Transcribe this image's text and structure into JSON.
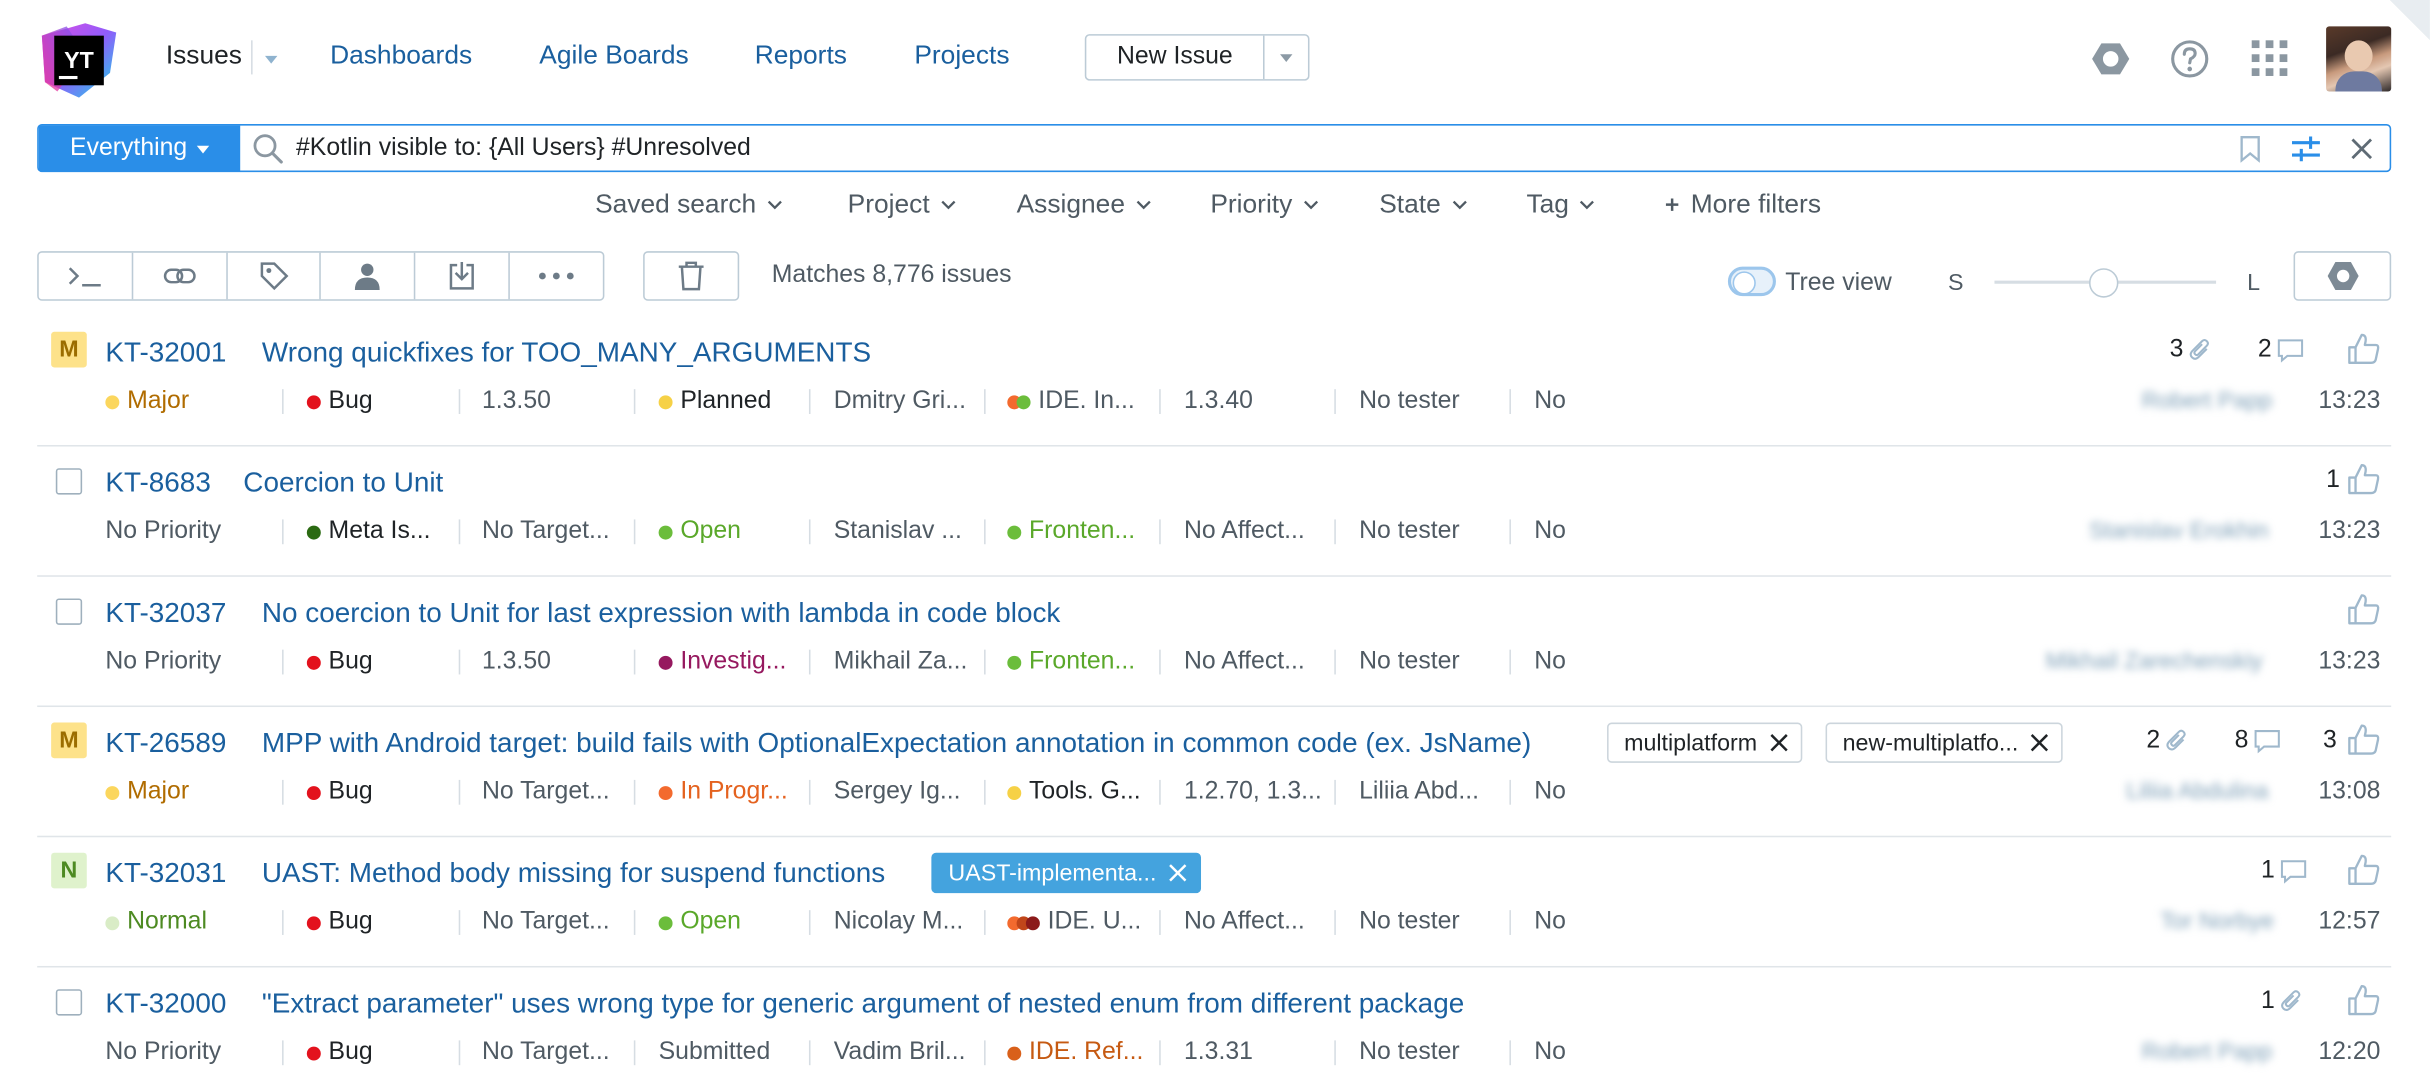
{
  "header": {
    "logo_text": "YT",
    "nav": {
      "issues": "Issues",
      "dashboards": "Dashboards",
      "agile_boards": "Agile Boards",
      "reports": "Reports",
      "projects": "Projects"
    },
    "new_issue_label": "New Issue"
  },
  "search": {
    "scope": "Everything",
    "query": "#Kotlin visible to: {All Users} #Unresolved"
  },
  "filters": {
    "saved_search": "Saved search",
    "project": "Project",
    "assignee": "Assignee",
    "priority": "Priority",
    "state": "State",
    "tag": "Tag",
    "more": "More filters"
  },
  "toolbar": {
    "matches": "Matches 8,776 issues",
    "tree_view": "Tree view",
    "size_small": "S",
    "size_large": "L"
  },
  "colors": {
    "link": "#1a5f9e",
    "accent": "#2a8ee8",
    "major": "#fbd65d",
    "normal": "#d9ecc6",
    "bug": "#e3121d",
    "open": "#6bbd3b",
    "planned": "#f6d146",
    "investigating": "#96195f",
    "in_progress": "#f36a2e",
    "meta": "#2b6a12"
  },
  "issues": [
    {
      "id": "KT-32001",
      "summary": "Wrong quickfixes for TOO_MANY_ARGUMENTS",
      "badge": "M",
      "priority": "Major",
      "type": "Bug",
      "target": "1.3.50",
      "state": "Planned",
      "assignee": "Dmitry Gri...",
      "subsystem": "IDE. In...",
      "affected": "1.3.40",
      "tester": "No tester",
      "flag": "No",
      "attachments": "3",
      "comments": "2",
      "votes": "",
      "reporter": "Robert Papp",
      "time": "13:23"
    },
    {
      "id": "KT-8683",
      "summary": "Coercion to Unit",
      "badge": "",
      "priority": "No Priority",
      "type": "Meta Is...",
      "target": "No Target...",
      "state": "Open",
      "assignee": "Stanislav ...",
      "subsystem": "Fronten...",
      "affected": "No Affect...",
      "tester": "No tester",
      "flag": "No",
      "votes": "1",
      "reporter": "Stanislav Erokhin",
      "time": "13:23"
    },
    {
      "id": "KT-32037",
      "summary": "No coercion to Unit for last expression with lambda in code block",
      "badge": "",
      "priority": "No Priority",
      "type": "Bug",
      "target": "1.3.50",
      "state": "Investig...",
      "assignee": "Mikhail Za...",
      "subsystem": "Fronten...",
      "affected": "No Affect...",
      "tester": "No tester",
      "flag": "No",
      "votes": "",
      "reporter": "Mikhail Zarechenskiy",
      "time": "13:23"
    },
    {
      "id": "KT-26589",
      "summary": "MPP with Android target: build fails with OptionalExpectation annotation in common code (ex. JsName)",
      "badge": "M",
      "tags": [
        "multiplatform",
        "new-multiplatfo..."
      ],
      "priority": "Major",
      "type": "Bug",
      "target": "No Target...",
      "state": "In Progr...",
      "assignee": "Sergey Ig...",
      "subsystem": "Tools. G...",
      "affected": "1.2.70, 1.3...",
      "tester": "Liliia Abd...",
      "flag": "No",
      "attachments": "2",
      "comments": "8",
      "votes": "3",
      "reporter": "Liliia Abdulina",
      "time": "13:08"
    },
    {
      "id": "KT-32031",
      "summary": "UAST: Method body missing for suspend functions",
      "badge": "N",
      "tags": [
        "UAST-implementa..."
      ],
      "priority": "Normal",
      "type": "Bug",
      "target": "No Target...",
      "state": "Open",
      "assignee": "Nicolay M...",
      "subsystem": "IDE. U...",
      "affected": "No Affect...",
      "tester": "No tester",
      "flag": "No",
      "comments": "1",
      "votes": "",
      "reporter": "Tor Norbye",
      "time": "12:57"
    },
    {
      "id": "KT-32000",
      "summary": "\"Extract parameter\" uses wrong type for generic argument of nested enum from different package",
      "badge": "",
      "priority": "No Priority",
      "type": "Bug",
      "target": "No Target...",
      "state": "Submitted",
      "assignee": "Vadim Bril...",
      "subsystem": "IDE. Ref...",
      "affected": "1.3.31",
      "tester": "No tester",
      "flag": "No",
      "attachments": "1",
      "votes": "",
      "reporter": "Robert Papp",
      "time": "12:20"
    }
  ]
}
